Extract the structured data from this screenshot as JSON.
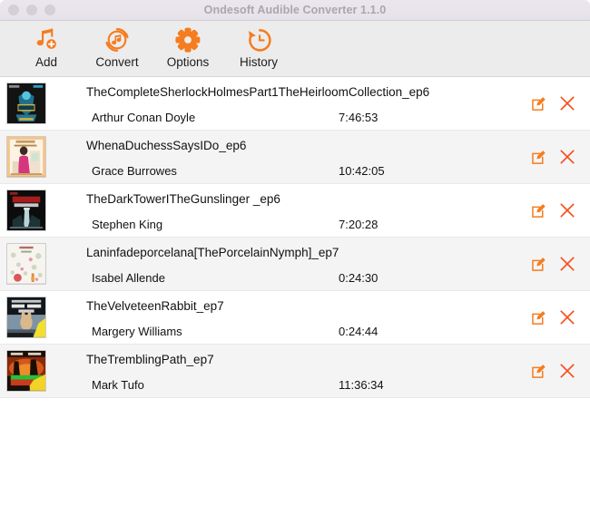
{
  "window": {
    "title": "Ondesoft Audible Converter 1.1.0",
    "traffic_lights": [
      "close-button",
      "minimize-button",
      "zoom-button"
    ]
  },
  "colors": {
    "accent": "#f57c1f",
    "titlebar": "#e8e4ea",
    "toolbar": "#ececec",
    "row_odd": "#ffffff",
    "row_even": "#f4f4f4",
    "text": "#111111",
    "title_text": "#a9a6ae"
  },
  "toolbar": {
    "items": [
      {
        "label": "Add",
        "icon": "music-note-plus-icon"
      },
      {
        "label": "Convert",
        "icon": "music-note-refresh-icon"
      },
      {
        "label": "Options",
        "icon": "gear-icon"
      },
      {
        "label": "History",
        "icon": "clock-rewind-icon"
      }
    ]
  },
  "list": {
    "row_actions": {
      "edit": "edit-icon",
      "remove": "remove-icon"
    },
    "rows": [
      {
        "title": "TheCompleteSherlockHolmesPart1TheHeirloomCollection_ep6",
        "author": "Arthur Conan Doyle",
        "duration": "7:46:53",
        "cover": "sherlock-holmes-cover"
      },
      {
        "title": "WhenaDuchessSaysIDo_ep6",
        "author": "Grace Burrowes",
        "duration": "10:42:05",
        "cover": "duchess-cover"
      },
      {
        "title": "TheDarkTowerITheGunslinger _ep6",
        "author": "Stephen King",
        "duration": "7:20:28",
        "cover": "dark-tower-cover"
      },
      {
        "title": "Laninfadeporcelana[ThePorcelainNymph]_ep7",
        "author": "Isabel Allende",
        "duration": "0:24:30",
        "cover": "porcelain-nymph-cover"
      },
      {
        "title": "TheVelveteenRabbit_ep7",
        "author": "Margery Williams",
        "duration": "0:24:44",
        "cover": "velveteen-rabbit-cover"
      },
      {
        "title": "TheTremblingPath_ep7",
        "author": "Mark Tufo",
        "duration": "11:36:34",
        "cover": "trembling-path-cover"
      }
    ]
  }
}
